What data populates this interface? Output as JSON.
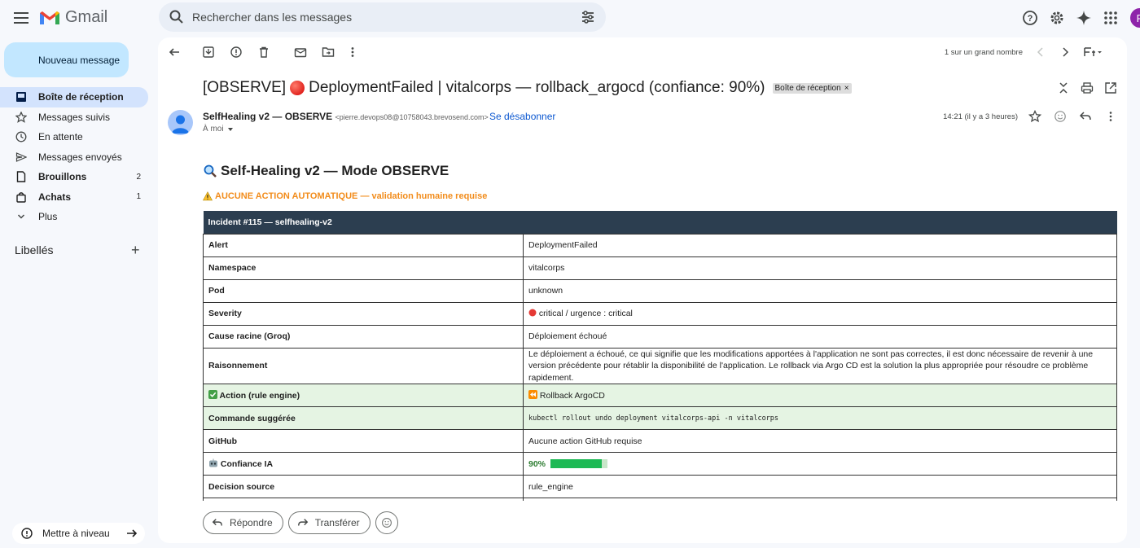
{
  "app": {
    "name": "Gmail"
  },
  "search": {
    "placeholder": "Rechercher dans les messages"
  },
  "compose": {
    "label": "Nouveau message"
  },
  "nav": {
    "items": [
      {
        "label": "Boîte de réception",
        "count": ""
      },
      {
        "label": "Messages suivis",
        "count": ""
      },
      {
        "label": "En attente",
        "count": ""
      },
      {
        "label": "Messages envoyés",
        "count": ""
      },
      {
        "label": "Brouillons",
        "count": "2"
      },
      {
        "label": "Achats",
        "count": "1"
      },
      {
        "label": "Plus",
        "count": ""
      }
    ]
  },
  "labels": {
    "title": "Libellés"
  },
  "upgrade": {
    "label": "Mettre à niveau"
  },
  "toolbar": {
    "pager": "1 sur un grand nombre"
  },
  "email": {
    "subject_prefix": "[OBSERVE]",
    "subject_text": "DeploymentFailed | vitalcorps — rollback_argocd (confiance: 90%)",
    "chip": "Boîte de réception",
    "sender_name": "SelfHealing v2 — OBSERVE",
    "sender_email": "<pierre.devops08@10758043.brevosend.com>",
    "unsubscribe": "Se désabonner",
    "to": "À moi",
    "date": "14:21 (il y a 3 heures)"
  },
  "body": {
    "title": "Self-Healing v2 — Mode OBSERVE",
    "warning": "AUCUNE ACTION AUTOMATIQUE — validation humaine requise",
    "table": {
      "header": "Incident #115 — selfhealing-v2",
      "rows": [
        {
          "key": "Alert",
          "value": "DeploymentFailed"
        },
        {
          "key": "Namespace",
          "value": "vitalcorps"
        },
        {
          "key": "Pod",
          "value": "unknown"
        },
        {
          "key": "Severity",
          "value": "critical / urgence : critical"
        },
        {
          "key": "Cause racine (Groq)",
          "value": "Déploiement échoué"
        },
        {
          "key": "Raisonnement",
          "value": "Le déploiement a échoué, ce qui signifie que les modifications apportées à l'application ne sont pas correctes, il est donc nécessaire de revenir à une version précédente pour rétablir la disponibilité de l'application. Le rollback via Argo CD est la solution la plus appropriée pour résoudre ce problème rapidement."
        },
        {
          "key": "Action (rule engine)",
          "value": "Rollback ArgoCD"
        },
        {
          "key": "Commande suggérée",
          "value": "kubectl rollout undo deployment vitalcorps-api -n vitalcorps"
        },
        {
          "key": "GitHub",
          "value": "Aucune action GitHub requise"
        },
        {
          "key": "Confiance IA",
          "value": "90%",
          "level": 0.9
        },
        {
          "key": "Decision source",
          "value": "rule_engine"
        }
      ]
    }
  },
  "actions": {
    "reply": "Répondre",
    "forward": "Transférer"
  },
  "colors": {
    "header_bg": "#2c3e50",
    "accent": "#0b57d0",
    "warning": "#f28c1b",
    "compose_bg": "#c2e7ff",
    "active_nav": "#d3e3fd",
    "green_row": "#e5f4e3"
  }
}
